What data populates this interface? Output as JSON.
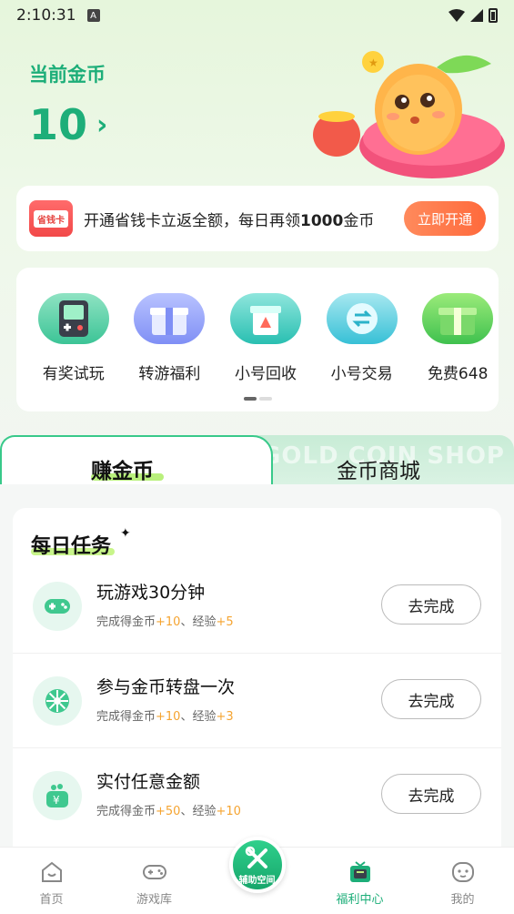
{
  "status_bar": {
    "time": "2:10:31",
    "a_badge": "A"
  },
  "header": {
    "coins_label": "当前金币",
    "coins_value": "10"
  },
  "promo": {
    "badge": "省钱卡",
    "text_pre": "开通省钱卡立返全额，每日再领",
    "text_bold": "1000",
    "text_post": "金币",
    "button": "立即开通"
  },
  "shortcuts": {
    "items": [
      {
        "label": "有奖试玩",
        "icon": "handheld-console-icon"
      },
      {
        "label": "转游福利",
        "icon": "gift-box-icon"
      },
      {
        "label": "小号回收",
        "icon": "recycle-box-icon"
      },
      {
        "label": "小号交易",
        "icon": "exchange-coin-icon"
      },
      {
        "label": "免费648",
        "icon": "green-gift-icon"
      }
    ]
  },
  "tabs": {
    "earn": "赚金币",
    "shop": "金币商城",
    "shop_ghost": "GOLD COIN SHOP"
  },
  "tasks": {
    "title": "每日任务",
    "items": [
      {
        "name": "玩游戏30分钟",
        "reward_pre": "完成得金币",
        "coin": "+10",
        "sep": "、经验",
        "exp": "+5",
        "button": "去完成",
        "icon": "gamepad-icon"
      },
      {
        "name": "参与金币转盘一次",
        "reward_pre": "完成得金币",
        "coin": "+10",
        "sep": "、经验",
        "exp": "+3",
        "button": "去完成",
        "icon": "wheel-icon"
      },
      {
        "name": "实付任意金额",
        "reward_pre": "完成得金币",
        "coin": "+50",
        "sep": "、经验",
        "exp": "+10",
        "button": "去完成",
        "icon": "wallet-yen-icon"
      }
    ]
  },
  "bottom_nav": {
    "items": [
      {
        "label": "首页",
        "icon": "home-icon"
      },
      {
        "label": "游戏库",
        "icon": "gamepad-icon"
      },
      {
        "label": "辅助空间",
        "icon": "tools-icon"
      },
      {
        "label": "福利中心",
        "icon": "tv-gift-icon"
      },
      {
        "label": "我的",
        "icon": "profile-face-icon"
      }
    ],
    "active": "福利中心"
  },
  "colors": {
    "accent": "#1dae79",
    "orange": "#ff6a3c",
    "reward": "#f5a431"
  }
}
